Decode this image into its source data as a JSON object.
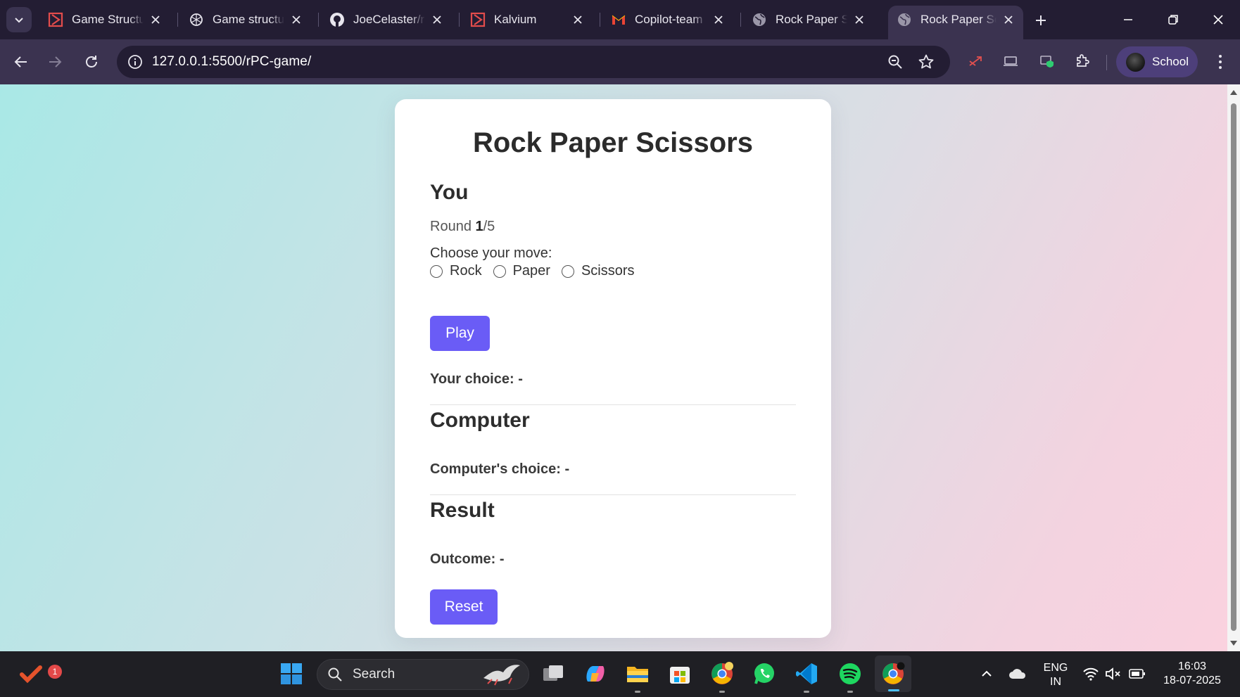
{
  "browser": {
    "tabs": [
      {
        "title": "Game Structur",
        "icon": "kalvium-icon"
      },
      {
        "title": "Game structur",
        "icon": "chatgpt-icon"
      },
      {
        "title": "JoeCelaster/rP",
        "icon": "github-icon"
      },
      {
        "title": "Kalvium",
        "icon": "kalvium-icon"
      },
      {
        "title": "Copilot-team",
        "icon": "gmail-icon"
      },
      {
        "title": "Rock Paper Sc",
        "icon": "globe-icon"
      },
      {
        "title": "Rock Paper Sc",
        "icon": "globe-icon",
        "active": true
      }
    ],
    "address": "127.0.0.1:5500/rPC-game/",
    "profile_name": "School"
  },
  "game": {
    "title": "Rock Paper Scissors",
    "you_heading": "You",
    "round_label": "Round",
    "round_current": "1",
    "round_total": "/5",
    "choose_label": "Choose your move:",
    "options": [
      "Rock",
      "Paper",
      "Scissors"
    ],
    "play_label": "Play",
    "your_choice": "Your choice: -",
    "computer_heading": "Computer",
    "computer_choice": "Computer's choice: -",
    "result_heading": "Result",
    "outcome": "Outcome: -",
    "reset_label": "Reset",
    "accent_color": "#6a5cf6"
  },
  "taskbar": {
    "search_placeholder": "Search",
    "notification_count": "1",
    "lang_top": "ENG",
    "lang_bottom": "IN",
    "time": "16:03",
    "date": "18-07-2025"
  }
}
